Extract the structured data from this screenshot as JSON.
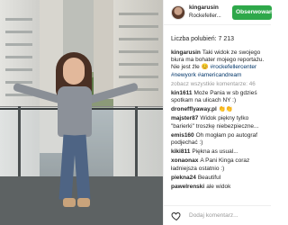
{
  "post": {
    "username": "kingarusin",
    "location": "Rockefeller...",
    "follow_label": "Obserwowanie",
    "likes_label": "Liczba polubień: 7 213",
    "caption_user": "kingarusin",
    "caption_text": "Taki widok ze swojego biura ma bohater mojego reportażu. Nie jest źle",
    "caption_tags": "#rockefellercenter #newyork #americandream",
    "view_all": "zobacz wszystkie komentarze: 46"
  },
  "comments": [
    {
      "user": "kin1611",
      "text": "Może Pania w sb gdzieś spotkam na ulicach NY :)"
    },
    {
      "user": "dronefflyaway.pl",
      "text": "👏👏"
    },
    {
      "user": "majster87",
      "text": "Widok piękny tylko \"barierki\" troszkę niebezpieczne..."
    },
    {
      "user": "emis160",
      "text": "Oh mogłam po autograf podjechać :)"
    },
    {
      "user": "kiki811",
      "text": "Piękna as usual..."
    },
    {
      "user": "xonaonax",
      "text": "A Pani Kinga coraz ładniejsza ostatnio :)"
    },
    {
      "user": "piekna24",
      "text": "Beautiful"
    },
    {
      "user": "pawelrenski",
      "text": "ale widok"
    }
  ],
  "footer": {
    "add_comment_placeholder": "Dodaj komentarz..."
  },
  "icons": {
    "heart": "heart-icon",
    "avatar": "avatar"
  },
  "colors": {
    "follow_button": "#2ea84a",
    "hashtag": "#003569"
  }
}
